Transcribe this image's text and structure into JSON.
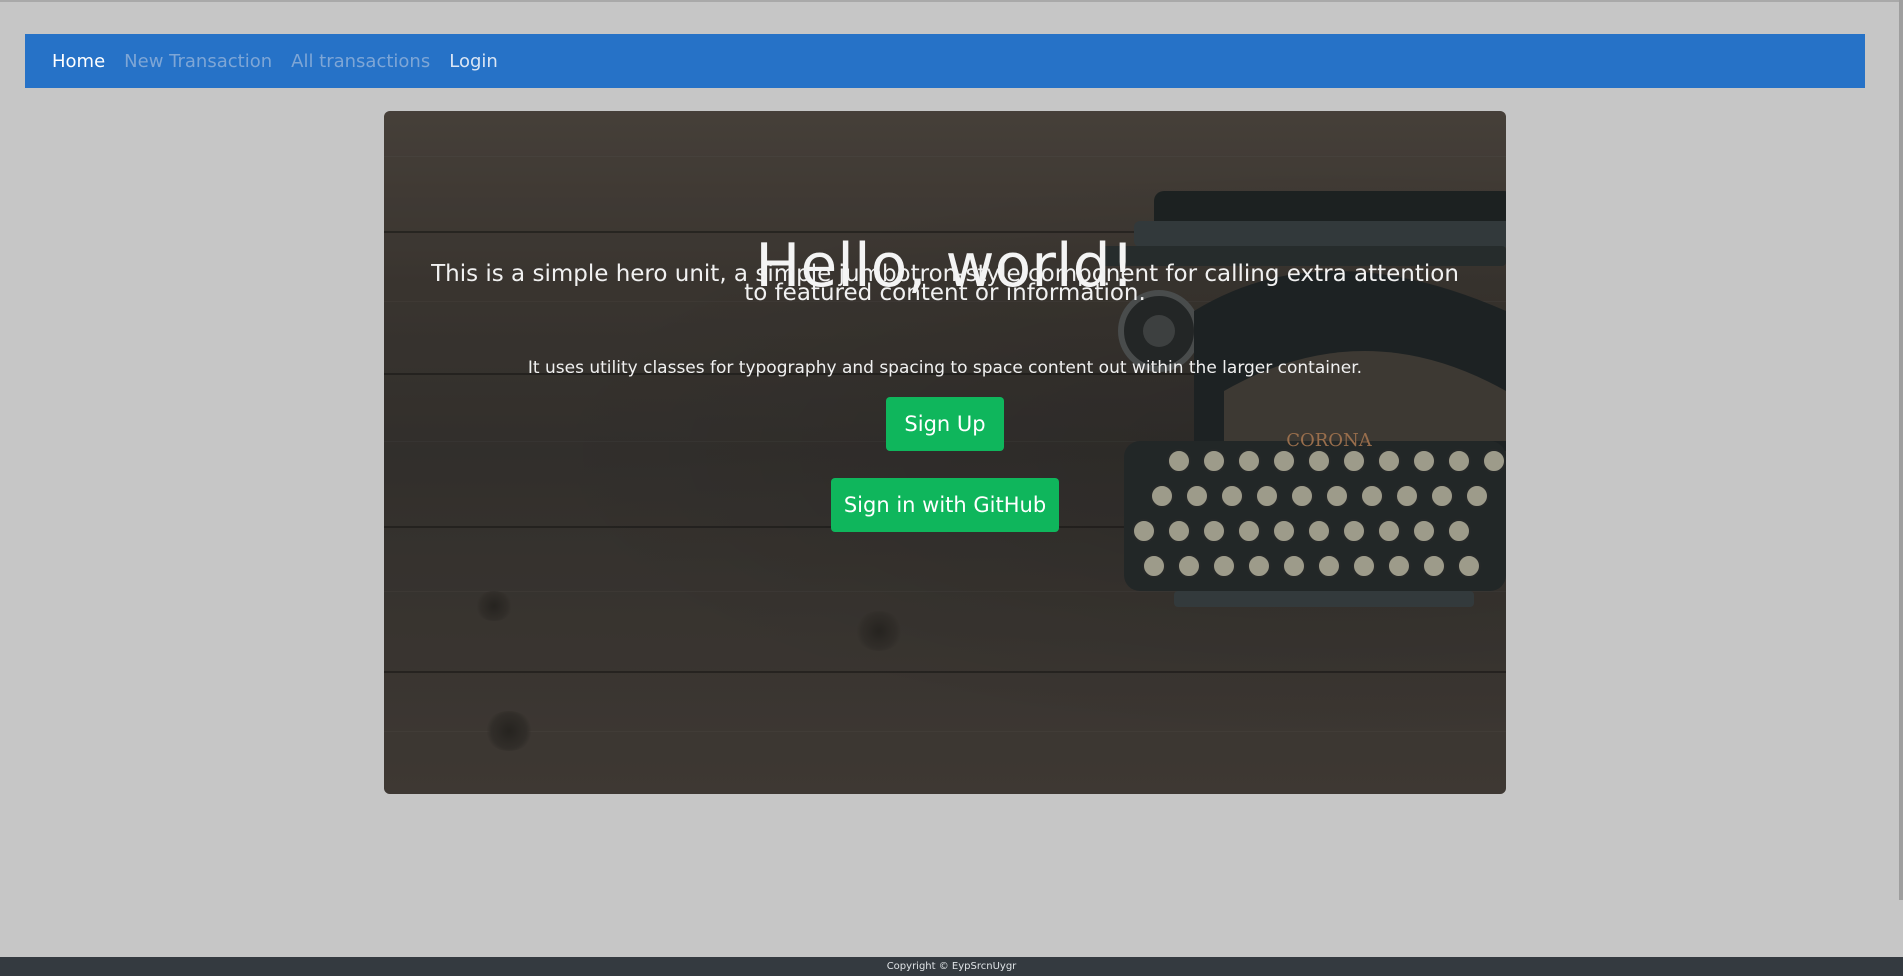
{
  "nav": {
    "items": [
      {
        "label": "Home"
      },
      {
        "label": "New Transaction"
      },
      {
        "label": "All transactions"
      },
      {
        "label": "Login"
      }
    ]
  },
  "hero": {
    "title": "Hello, world!",
    "lead_line1": "This is a simple hero unit, a simple jumbotron-style component for calling extra attention",
    "lead_line2": "to featured content or information.",
    "text": "It uses utility classes for typography and spacing to space content out within the larger container.",
    "signup_label": "Sign Up",
    "github_label": "Sign in with GitHub",
    "typewriter_brand": "CORONA"
  },
  "footer": {
    "copyright": "Copyright © EypSrcnUygr"
  },
  "colors": {
    "navbar": "#2672c7",
    "button": "#0fb65c",
    "footer": "#343a40",
    "page_bg": "#c6c6c6"
  }
}
